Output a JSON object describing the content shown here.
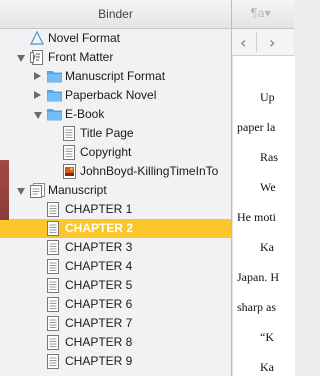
{
  "binder": {
    "title": "Binder",
    "items": [
      {
        "label": "Novel Format",
        "level": 0,
        "icon": "triangle-template-icon",
        "expand": "none"
      },
      {
        "label": "Front Matter",
        "level": 0,
        "icon": "front-matter-icon",
        "expand": "open"
      },
      {
        "label": "Manuscript Format",
        "level": 1,
        "icon": "folder-icon",
        "expand": "closed"
      },
      {
        "label": "Paperback Novel",
        "level": 1,
        "icon": "folder-icon",
        "expand": "closed"
      },
      {
        "label": "E-Book",
        "level": 1,
        "icon": "folder-icon",
        "expand": "open"
      },
      {
        "label": "Title Page",
        "level": 2,
        "icon": "document-icon",
        "expand": "none"
      },
      {
        "label": "Copyright",
        "level": 2,
        "icon": "document-icon",
        "expand": "none"
      },
      {
        "label": "JohnBoyd-KillingTimeInTo",
        "level": 2,
        "icon": "image-file-icon",
        "expand": "none"
      },
      {
        "label": "Manuscript",
        "level": 0,
        "icon": "manuscript-icon",
        "expand": "open"
      },
      {
        "label": "CHAPTER 1",
        "level": 1,
        "icon": "document-icon",
        "expand": "none"
      },
      {
        "label": "CHAPTER 2",
        "level": 1,
        "icon": "document-icon",
        "expand": "none",
        "selected": true
      },
      {
        "label": "CHAPTER 3",
        "level": 1,
        "icon": "document-icon",
        "expand": "none"
      },
      {
        "label": "CHAPTER 4",
        "level": 1,
        "icon": "document-icon",
        "expand": "none"
      },
      {
        "label": "CHAPTER 5",
        "level": 1,
        "icon": "document-icon",
        "expand": "none"
      },
      {
        "label": "CHAPTER 6",
        "level": 1,
        "icon": "document-icon",
        "expand": "none"
      },
      {
        "label": "CHAPTER 7",
        "level": 1,
        "icon": "document-icon",
        "expand": "none"
      },
      {
        "label": "CHAPTER 8",
        "level": 1,
        "icon": "document-icon",
        "expand": "none"
      },
      {
        "label": "CHAPTER 9",
        "level": 1,
        "icon": "document-icon",
        "expand": "none"
      }
    ]
  },
  "editor": {
    "paragraph_style_icon": "paragraph-icon",
    "nav_back": "‹",
    "nav_forward": "›",
    "lines": [
      "Up",
      "paper la",
      "Ras",
      "We",
      "He moti",
      "Ka",
      "Japan. H",
      "sharp as",
      "“K",
      "Ka"
    ]
  },
  "colors": {
    "selection": "#fac62a",
    "folder": "#5aa9e6"
  }
}
